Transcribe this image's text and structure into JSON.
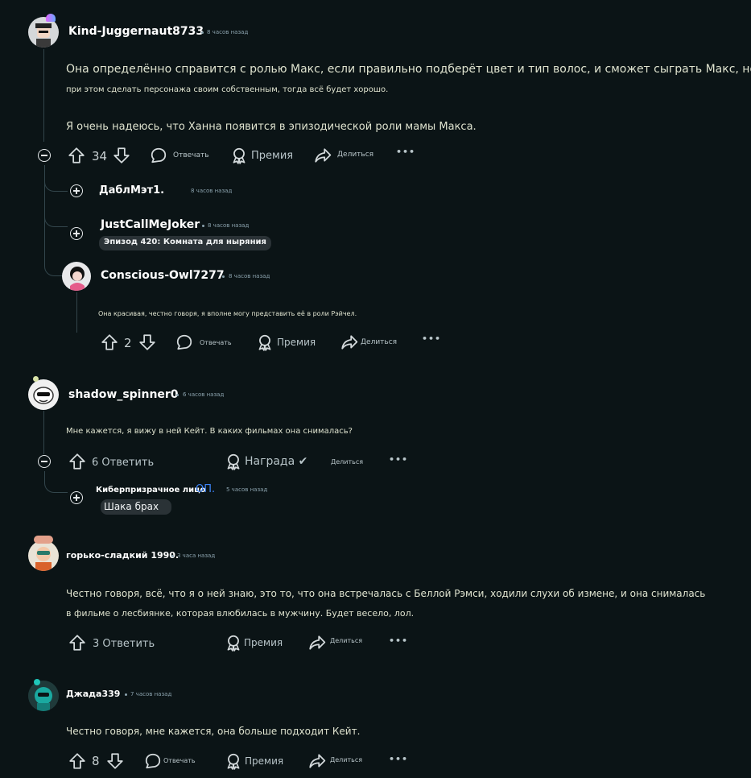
{
  "colors": {
    "background": "#0b1416",
    "thread": "#33464c",
    "op_accent": "#3b82f6",
    "text": "#dfe3cf"
  },
  "comments": [
    {
      "user": "Kind-Juggernaut8733",
      "time": "8 часов назад",
      "lines": [
        "Она определённо справится с ролью Макс, если правильно подберёт цвет и тип волос, и сможет сыграть Макс, но",
        "при этом сделать персонажа своим собственным, тогда всё будет хорошо.",
        "Я очень надеюсь, что Ханна появится в эпизодической роли мамы Макса."
      ],
      "votes": "34",
      "reply": "Отвечать",
      "award": "Премия",
      "share": "Делиться",
      "more": "•••"
    },
    {
      "user": "ДаблМэт1.",
      "time": "8 часов назад"
    },
    {
      "user": "JustCallMeJoker",
      "time": "8 часов назад",
      "flair": "Эпизод 420: Комната для ныряния"
    },
    {
      "user": "Conscious-Owl7277",
      "time": "8 часов назад",
      "text": "Она красивая, честно говоря, я вполне могу представить её в роли Рэйчел.",
      "votes": "2",
      "reply": "Отвечать",
      "award": "Премия",
      "share": "Делиться",
      "more": "•••"
    },
    {
      "user": "shadow_spinner0",
      "time": "6 часов назад",
      "text": "Мне кажется, я вижу в ней Кейт. В каких фильмах она снималась?",
      "reply": "6 Ответить",
      "award": "Награда ✔",
      "share": "Делиться",
      "more": "•••"
    },
    {
      "user": "Киберпризрачное лицо",
      "op": "ОП.",
      "time": "5 часов назад",
      "flair": "Шака брах"
    },
    {
      "user": "горько-сладкий 1990.",
      "time": "3 часа назад",
      "lines": [
        "Честно говоря, всё, что я о ней знаю, это то, что она встречалась с Беллой Рэмси, ходили слухи об измене, и она снималась",
        "в фильме о лесбиянке, которая влюбилась в мужчину. Будет весело, лол."
      ],
      "reply": "3 Ответить",
      "award": "Премия",
      "share": "Делиться",
      "more": "•••"
    },
    {
      "user": "Джада339",
      "time": "7 часов назад",
      "text": "Честно говоря, мне кажется, она больше подходит Кейт.",
      "votes": "8",
      "reply": "Отвечать",
      "award": "Премия",
      "share": "Делиться",
      "more": "•••"
    }
  ],
  "icons": [
    "upvote-icon",
    "downvote-icon",
    "comment-icon",
    "award-icon",
    "share-icon",
    "collapse-icon",
    "expand-icon"
  ]
}
